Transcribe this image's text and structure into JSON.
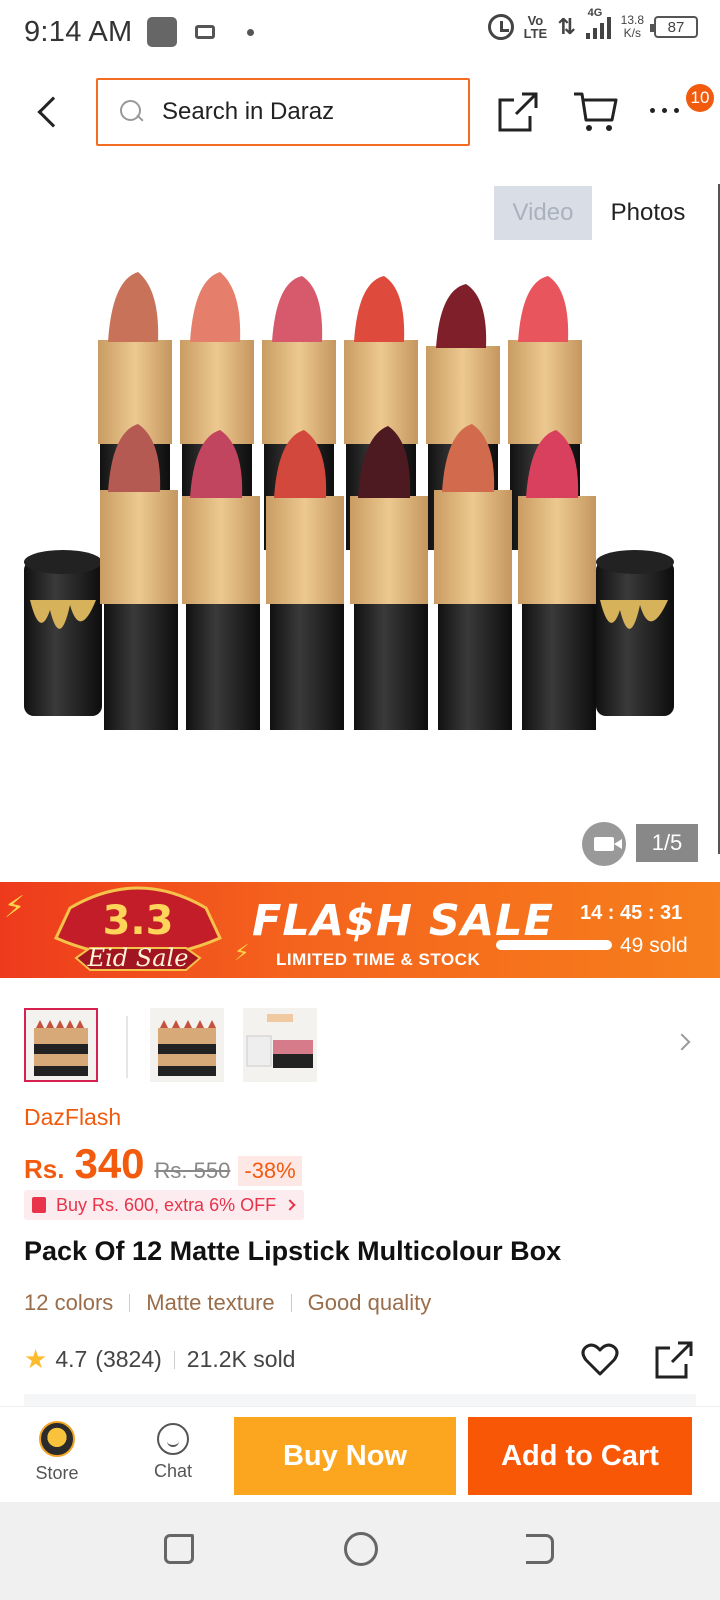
{
  "status_bar": {
    "time": "9:14 AM",
    "volte": "Vo\nLTE",
    "network": "4G",
    "net_speed_value": "13.8",
    "net_speed_unit": "K/s",
    "battery": "87"
  },
  "header": {
    "search_placeholder": "Search in Daraz",
    "more_badge": "10",
    "icons": [
      "back-icon",
      "search-icon",
      "share-icon",
      "cart-icon",
      "more-icon"
    ]
  },
  "media": {
    "tabs": [
      "Video",
      "Photos"
    ],
    "active_tab": "Video",
    "counter": "1/5"
  },
  "flash_sale": {
    "badge_top": "3.3",
    "badge_bottom": "Eid Sale",
    "title": "FLA$H SALE",
    "subtitle": "LIMITED TIME & STOCK",
    "timer": "14 : 45 : 31",
    "sold": "49 sold",
    "sold_progress": 0.95
  },
  "product": {
    "brand": "DazFlash",
    "currency": "Rs.",
    "price": "340",
    "original_price": "Rs. 550",
    "discount": "-38%",
    "promo": "Buy Rs. 600, extra 6% OFF",
    "title": "Pack Of 12 Matte Lipstick Multicolour Box",
    "tags": [
      "12 colors",
      "Matte texture",
      "Good quality"
    ],
    "rating": "4.7",
    "reviews": "(3824)",
    "sold": "21.2K sold"
  },
  "bottom_bar": {
    "store_label": "Store",
    "chat_label": "Chat",
    "buy_now": "Buy Now",
    "add_to_cart": "Add to Cart"
  },
  "colors": {
    "brand_orange": "#f25a0e",
    "buy_now": "#fca620",
    "add_to_cart": "#f85705"
  }
}
